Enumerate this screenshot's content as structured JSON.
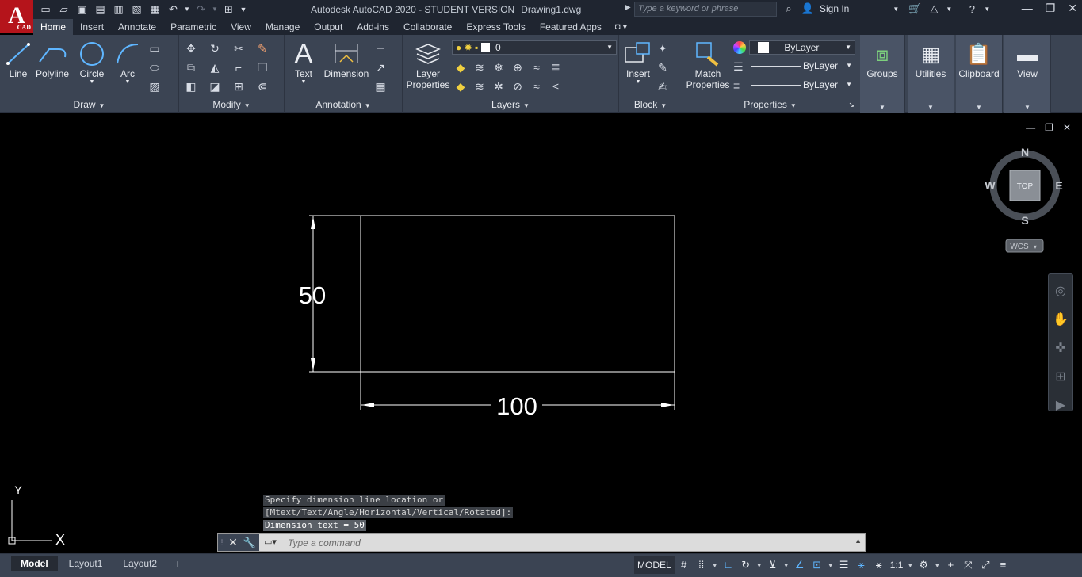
{
  "app": {
    "logo_letter": "A",
    "logo_sub": "CAD",
    "title": "Autodesk AutoCAD 2020 - STUDENT VERSION",
    "filename": "Drawing1.dwg",
    "search_placeholder": "Type a keyword or phrase",
    "sign_in": "Sign In"
  },
  "tabs": [
    "Home",
    "Insert",
    "Annotate",
    "Parametric",
    "View",
    "Manage",
    "Output",
    "Add-ins",
    "Collaborate",
    "Express Tools",
    "Featured Apps"
  ],
  "ribbon": {
    "draw": {
      "title": "Draw",
      "line": "Line",
      "polyline": "Polyline",
      "circle": "Circle",
      "arc": "Arc"
    },
    "modify": {
      "title": "Modify"
    },
    "annotation": {
      "title": "Annotation",
      "text": "Text",
      "dimension": "Dimension"
    },
    "layers": {
      "title": "Layers",
      "layer_properties_1": "Layer",
      "layer_properties_2": "Properties",
      "current_layer": "0"
    },
    "block": {
      "title": "Block",
      "insert": "Insert"
    },
    "properties": {
      "title": "Properties",
      "match_1": "Match",
      "match_2": "Properties",
      "color": "ByLayer",
      "linetype": "ByLayer",
      "lineweight": "ByLayer"
    },
    "groups": "Groups",
    "utilities": "Utilities",
    "clipboard": "Clipboard",
    "view": "View"
  },
  "viewcube": {
    "n": "N",
    "s": "S",
    "e": "E",
    "w": "W",
    "top": "TOP",
    "wcs": "WCS"
  },
  "drawing": {
    "dim_vertical": "50",
    "dim_horizontal": "100"
  },
  "ucs": {
    "x": "X",
    "y": "Y"
  },
  "command": {
    "history": [
      "Specify dimension line location or",
      "[Mtext/Text/Angle/Horizontal/Vertical/Rotated]:",
      "Dimension text = 50"
    ],
    "placeholder": "Type a command"
  },
  "layout_tabs": [
    "Model",
    "Layout1",
    "Layout2"
  ],
  "status": {
    "model": "MODEL",
    "scale": "1:1"
  }
}
